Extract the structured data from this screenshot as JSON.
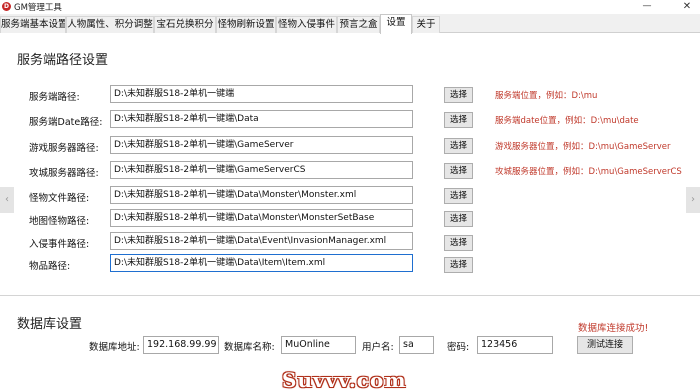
{
  "app": {
    "icon_letter": "D",
    "title": "GM管理工具",
    "minimize_glyph": "—",
    "close_glyph": "✕"
  },
  "tabs": [
    {
      "label": "服务端基本设置"
    },
    {
      "label": "人物属性、积分调整"
    },
    {
      "label": "宝石兑换积分"
    },
    {
      "label": "怪物刷新设置"
    },
    {
      "label": "怪物入侵事件"
    },
    {
      "label": "预言之盒"
    },
    {
      "label": "设置",
      "active": true
    },
    {
      "label": "关于"
    }
  ],
  "server_paths": {
    "title": "服务端路径设置",
    "choose_label": "选择",
    "rows": [
      {
        "label": "服务端路径:",
        "value": "D:\\未知群服S18-2单机一键端",
        "hint": "服务端位置，例如：D:\\mu"
      },
      {
        "label": "服务端Date路径:",
        "value": "D:\\未知群服S18-2单机一键端\\Data",
        "hint": "服务端date位置，例如：D:\\mu\\date"
      },
      {
        "label": "游戏服务器路径:",
        "value": "D:\\未知群服S18-2单机一键端\\GameServer",
        "hint": "游戏服务器位置，例如：D:\\mu\\GameServer"
      },
      {
        "label": "攻城服务器路径:",
        "value": "D:\\未知群服S18-2单机一键端\\GameServerCS",
        "hint": "攻城服务器位置，例如：D:\\mu\\GameServerCS"
      },
      {
        "label": "怪物文件路径:",
        "value": "D:\\未知群服S18-2单机一键端\\Data\\Monster\\Monster.xml",
        "hint": ""
      },
      {
        "label": "地图怪物路径:",
        "value": "D:\\未知群服S18-2单机一键端\\Data\\Monster\\MonsterSetBase",
        "hint": ""
      },
      {
        "label": "入侵事件路径:",
        "value": "D:\\未知群服S18-2单机一键端\\Data\\Event\\InvasionManager.xml",
        "hint": ""
      },
      {
        "label": "物品路径:",
        "value": "D:\\未知群服S18-2单机一键端\\Data\\Item\\Item.xml",
        "hint": ""
      }
    ]
  },
  "database": {
    "title": "数据库设置",
    "status": "数据库连接成功!",
    "address_label": "数据库地址:",
    "address_value": "192.168.99.99",
    "name_label": "数据库名称:",
    "name_value": "MuOnline",
    "user_label": "用户名:",
    "user_value": "sa",
    "password_label": "密码:",
    "password_value": "123456",
    "test_button": "测试连接"
  },
  "nav": {
    "left_arrow": "‹",
    "right_arrow": "›"
  },
  "watermark": "Suvvv.com"
}
